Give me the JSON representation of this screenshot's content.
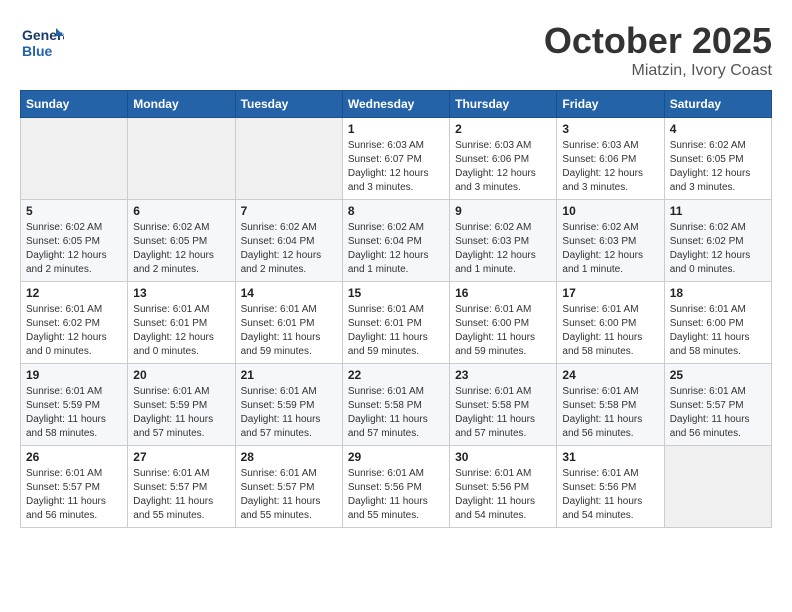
{
  "header": {
    "logo_text_general": "General",
    "logo_text_blue": "Blue",
    "month": "October 2025",
    "location": "Miatzin, Ivory Coast"
  },
  "days_of_week": [
    "Sunday",
    "Monday",
    "Tuesday",
    "Wednesday",
    "Thursday",
    "Friday",
    "Saturday"
  ],
  "weeks": [
    [
      {
        "day": "",
        "info": ""
      },
      {
        "day": "",
        "info": ""
      },
      {
        "day": "",
        "info": ""
      },
      {
        "day": "1",
        "info": "Sunrise: 6:03 AM\nSunset: 6:07 PM\nDaylight: 12 hours\nand 3 minutes."
      },
      {
        "day": "2",
        "info": "Sunrise: 6:03 AM\nSunset: 6:06 PM\nDaylight: 12 hours\nand 3 minutes."
      },
      {
        "day": "3",
        "info": "Sunrise: 6:03 AM\nSunset: 6:06 PM\nDaylight: 12 hours\nand 3 minutes."
      },
      {
        "day": "4",
        "info": "Sunrise: 6:02 AM\nSunset: 6:05 PM\nDaylight: 12 hours\nand 3 minutes."
      }
    ],
    [
      {
        "day": "5",
        "info": "Sunrise: 6:02 AM\nSunset: 6:05 PM\nDaylight: 12 hours\nand 2 minutes."
      },
      {
        "day": "6",
        "info": "Sunrise: 6:02 AM\nSunset: 6:05 PM\nDaylight: 12 hours\nand 2 minutes."
      },
      {
        "day": "7",
        "info": "Sunrise: 6:02 AM\nSunset: 6:04 PM\nDaylight: 12 hours\nand 2 minutes."
      },
      {
        "day": "8",
        "info": "Sunrise: 6:02 AM\nSunset: 6:04 PM\nDaylight: 12 hours\nand 1 minute."
      },
      {
        "day": "9",
        "info": "Sunrise: 6:02 AM\nSunset: 6:03 PM\nDaylight: 12 hours\nand 1 minute."
      },
      {
        "day": "10",
        "info": "Sunrise: 6:02 AM\nSunset: 6:03 PM\nDaylight: 12 hours\nand 1 minute."
      },
      {
        "day": "11",
        "info": "Sunrise: 6:02 AM\nSunset: 6:02 PM\nDaylight: 12 hours\nand 0 minutes."
      }
    ],
    [
      {
        "day": "12",
        "info": "Sunrise: 6:01 AM\nSunset: 6:02 PM\nDaylight: 12 hours\nand 0 minutes."
      },
      {
        "day": "13",
        "info": "Sunrise: 6:01 AM\nSunset: 6:01 PM\nDaylight: 12 hours\nand 0 minutes."
      },
      {
        "day": "14",
        "info": "Sunrise: 6:01 AM\nSunset: 6:01 PM\nDaylight: 11 hours\nand 59 minutes."
      },
      {
        "day": "15",
        "info": "Sunrise: 6:01 AM\nSunset: 6:01 PM\nDaylight: 11 hours\nand 59 minutes."
      },
      {
        "day": "16",
        "info": "Sunrise: 6:01 AM\nSunset: 6:00 PM\nDaylight: 11 hours\nand 59 minutes."
      },
      {
        "day": "17",
        "info": "Sunrise: 6:01 AM\nSunset: 6:00 PM\nDaylight: 11 hours\nand 58 minutes."
      },
      {
        "day": "18",
        "info": "Sunrise: 6:01 AM\nSunset: 6:00 PM\nDaylight: 11 hours\nand 58 minutes."
      }
    ],
    [
      {
        "day": "19",
        "info": "Sunrise: 6:01 AM\nSunset: 5:59 PM\nDaylight: 11 hours\nand 58 minutes."
      },
      {
        "day": "20",
        "info": "Sunrise: 6:01 AM\nSunset: 5:59 PM\nDaylight: 11 hours\nand 57 minutes."
      },
      {
        "day": "21",
        "info": "Sunrise: 6:01 AM\nSunset: 5:59 PM\nDaylight: 11 hours\nand 57 minutes."
      },
      {
        "day": "22",
        "info": "Sunrise: 6:01 AM\nSunset: 5:58 PM\nDaylight: 11 hours\nand 57 minutes."
      },
      {
        "day": "23",
        "info": "Sunrise: 6:01 AM\nSunset: 5:58 PM\nDaylight: 11 hours\nand 57 minutes."
      },
      {
        "day": "24",
        "info": "Sunrise: 6:01 AM\nSunset: 5:58 PM\nDaylight: 11 hours\nand 56 minutes."
      },
      {
        "day": "25",
        "info": "Sunrise: 6:01 AM\nSunset: 5:57 PM\nDaylight: 11 hours\nand 56 minutes."
      }
    ],
    [
      {
        "day": "26",
        "info": "Sunrise: 6:01 AM\nSunset: 5:57 PM\nDaylight: 11 hours\nand 56 minutes."
      },
      {
        "day": "27",
        "info": "Sunrise: 6:01 AM\nSunset: 5:57 PM\nDaylight: 11 hours\nand 55 minutes."
      },
      {
        "day": "28",
        "info": "Sunrise: 6:01 AM\nSunset: 5:57 PM\nDaylight: 11 hours\nand 55 minutes."
      },
      {
        "day": "29",
        "info": "Sunrise: 6:01 AM\nSunset: 5:56 PM\nDaylight: 11 hours\nand 55 minutes."
      },
      {
        "day": "30",
        "info": "Sunrise: 6:01 AM\nSunset: 5:56 PM\nDaylight: 11 hours\nand 54 minutes."
      },
      {
        "day": "31",
        "info": "Sunrise: 6:01 AM\nSunset: 5:56 PM\nDaylight: 11 hours\nand 54 minutes."
      },
      {
        "day": "",
        "info": ""
      }
    ]
  ]
}
